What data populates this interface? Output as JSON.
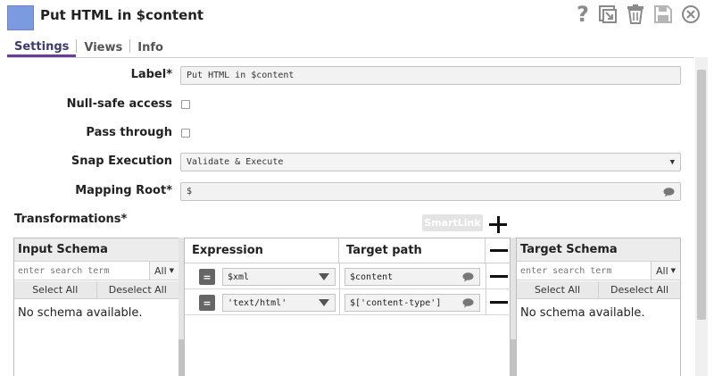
{
  "header": {
    "title": "Put HTML in $content",
    "swatch_color": "#7b9ae0",
    "icons": [
      "help-icon",
      "copy-window-icon",
      "trash-icon",
      "save-icon",
      "close-icon"
    ],
    "help_glyph": "?"
  },
  "tabs": [
    {
      "label": "Settings",
      "active": true
    },
    {
      "label": "Views",
      "active": false
    },
    {
      "label": "Info",
      "active": false
    }
  ],
  "form": {
    "label": {
      "label": "Label*",
      "value": "Put HTML in $content"
    },
    "null_safe": {
      "label": "Null-safe access",
      "checked": false
    },
    "pass_through": {
      "label": "Pass through",
      "checked": false
    },
    "snap_execution": {
      "label": "Snap Execution",
      "value": "Validate & Execute"
    },
    "mapping_root": {
      "label": "Mapping Root*",
      "value": "$"
    }
  },
  "transformations": {
    "label": "Transformations*",
    "smartlink_label": "SmartLink",
    "input_schema": {
      "title": "Input Schema",
      "search_placeholder": "enter search term",
      "filter_value": "All",
      "select_all": "Select All",
      "deselect_all": "Deselect All",
      "empty_text": "No schema available."
    },
    "table": {
      "expression_header": "Expression",
      "target_header": "Target path",
      "rows": [
        {
          "expression": "$xml",
          "target": "$content"
        },
        {
          "expression": "'text/html'",
          "target": "$['content-type']"
        }
      ],
      "eq_label": "="
    },
    "target_schema": {
      "title": "Target Schema",
      "search_placeholder": "enter search term",
      "filter_value": "All",
      "select_all": "Select All",
      "deselect_all": "Deselect All",
      "empty_text": "No schema available."
    }
  }
}
